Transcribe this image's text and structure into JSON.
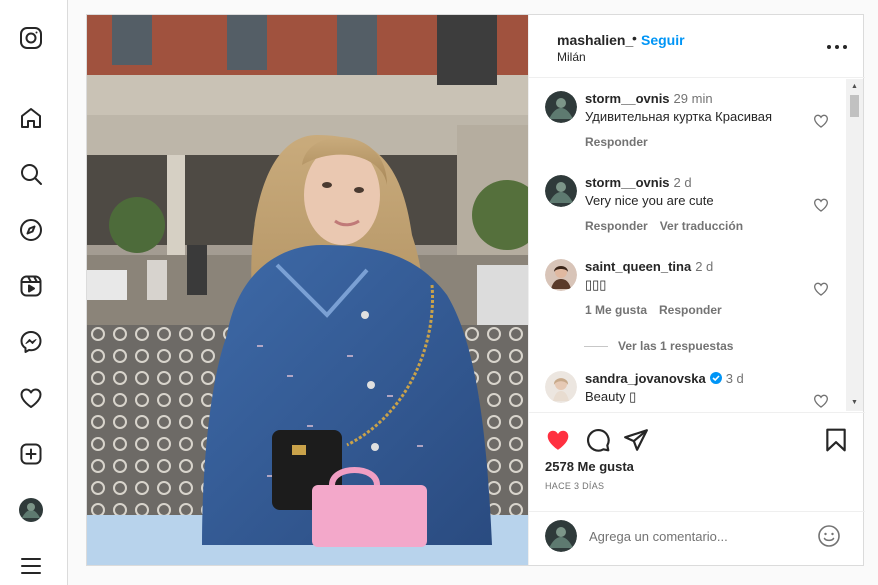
{
  "nav": {
    "icons": [
      "instagram-icon",
      "home-icon",
      "search-icon",
      "explore-icon",
      "reels-icon",
      "messenger-icon",
      "heart-icon",
      "create-icon",
      "profile-avatar",
      "menu-icon"
    ]
  },
  "post": {
    "header": {
      "username": "mashalien_",
      "separator": "•",
      "follow_label": "Seguir",
      "location": "Milán"
    },
    "comments": [
      {
        "username": "storm__ovnis",
        "time": "29 min",
        "text": "Удивительная куртка Красивая",
        "actions": [
          "Responder"
        ]
      },
      {
        "username": "storm__ovnis",
        "time": "2 d",
        "text": "Very nice you are cute",
        "actions": [
          "Responder",
          "Ver traducción"
        ]
      },
      {
        "username": "saint_queen_tina",
        "time": "2 d",
        "text": "▯▯▯",
        "actions": [
          "1 Me gusta",
          "Responder"
        ]
      },
      {
        "username": "sandra_jovanovska",
        "time": "3 d",
        "text": "Beauty ▯",
        "actions": []
      }
    ],
    "view_replies": "Ver las 1 respuestas",
    "likes": "2578 Me gusta",
    "date": "HACE 3 DÍAS",
    "comment_placeholder": "Agrega un comentario...",
    "colors": {
      "accent": "#0095f6",
      "like": "#ff3040",
      "text": "#262626",
      "muted": "#737373"
    }
  }
}
